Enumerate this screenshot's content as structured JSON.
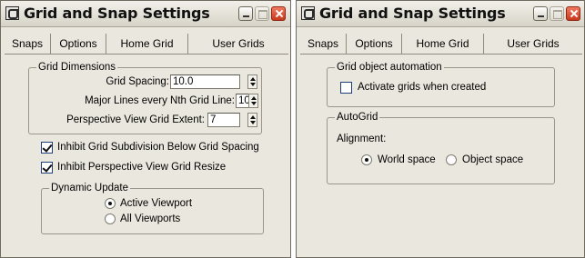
{
  "left_window": {
    "title": "Grid and Snap Settings",
    "tabs": [
      "Snaps",
      "Options",
      "Home Grid",
      "User Grids"
    ],
    "active_tab": "Home Grid",
    "grid_dimensions": {
      "legend": "Grid Dimensions",
      "grid_spacing_label": "Grid Spacing:",
      "grid_spacing_value": "10.0",
      "major_lines_label": "Major Lines every Nth Grid Line:",
      "major_lines_value": "10",
      "perspective_extent_label": "Perspective View Grid Extent:",
      "perspective_extent_value": "7"
    },
    "inhibit_subdivision_label": "Inhibit Grid Subdivision Below Grid Spacing",
    "inhibit_subdivision_checked": true,
    "inhibit_resize_label": "Inhibit Perspective View Grid Resize",
    "inhibit_resize_checked": true,
    "dynamic_update": {
      "legend": "Dynamic Update",
      "options": [
        "Active Viewport",
        "All Viewports"
      ],
      "selected": "Active Viewport"
    }
  },
  "right_window": {
    "title": "Grid and Snap Settings",
    "tabs": [
      "Snaps",
      "Options",
      "Home Grid",
      "User Grids"
    ],
    "active_tab": "User Grids",
    "grid_object_automation": {
      "legend": "Grid object automation",
      "activate_label": "Activate grids when created",
      "activate_checked": false
    },
    "autogrid": {
      "legend": "AutoGrid",
      "alignment_label": "Alignment:",
      "options": [
        "World space",
        "Object space"
      ],
      "selected": "World space"
    }
  }
}
